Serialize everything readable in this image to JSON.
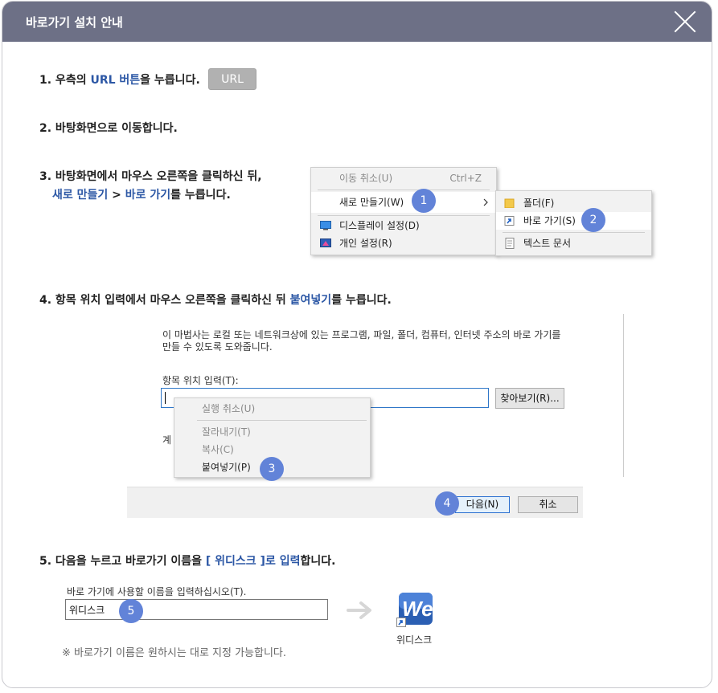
{
  "titlebar": {
    "title": "바로가기 설치 안내"
  },
  "steps": {
    "s1": {
      "prefix": "1. 우측의 ",
      "highlight": "URL 버튼",
      "suffix": "을 누릅니다.",
      "button": "URL"
    },
    "s2": {
      "text": "2. 바탕화면으로 이동합니다."
    },
    "s3": {
      "line1": "3. 바탕화면에서 마우스 오른쪽을 클릭하신 뒤,",
      "hl1": "새로 만들기",
      "mid": " > ",
      "hl2": "바로 가기",
      "suffix": "를 누릅니다."
    },
    "s4": {
      "prefix": "4. 항목 위치 입력에서 마우스 오른쪽을 클릭하신 뒤 ",
      "highlight": "붙여넣기",
      "suffix": "를 누릅니다."
    },
    "s5": {
      "prefix": "5. 다음을 누르고 바로가기 이름을 ",
      "highlight": "[ 위디스크 ]로 입력",
      "suffix": "합니다."
    }
  },
  "context_menu": {
    "undo": "이동 취소(U)",
    "undo_shortcut": "Ctrl+Z",
    "new": "새로 만들기(W)",
    "display": "디스플레이 설정(D)",
    "personal": "개인 설정(R)"
  },
  "submenu": {
    "folder": "폴더(F)",
    "shortcut": "바로 가기(S)",
    "textdoc": "텍스트 문서"
  },
  "wizard": {
    "desc_line1": "이 마법사는 로컬 또는 네트워크상에 있는 프로그램, 파일, 폴더, 컴퓨터, 인터넷 주소의 바로 가기를",
    "desc_line2": "만들 수 있도록 도와줍니다.",
    "location_label": "항목 위치 입력(T):",
    "browse": "찾아보기(R)...",
    "partial_label": "계",
    "menu_undo": "실행 취소(U)",
    "menu_cut": "잘라내기(T)",
    "menu_copy": "복사(C)",
    "menu_paste": "붙여넣기(P)",
    "next": "다음(N)",
    "cancel": "취소"
  },
  "name_step": {
    "label": "바로 가기에 사용할 이름을 입력하십시오(T).",
    "value": "위디스크",
    "icon_caption": "위디스크",
    "logo_text": "We"
  },
  "badges": [
    "1",
    "2",
    "3",
    "4",
    "5"
  ],
  "note": "※ 바로가기 이름은 원하시는 대로 지정 가능합니다.",
  "colors": {
    "titlebar": "#6d7086",
    "highlight": "#2c57a5",
    "badge": "#6283d8",
    "url_button": "#b1b1b1"
  }
}
